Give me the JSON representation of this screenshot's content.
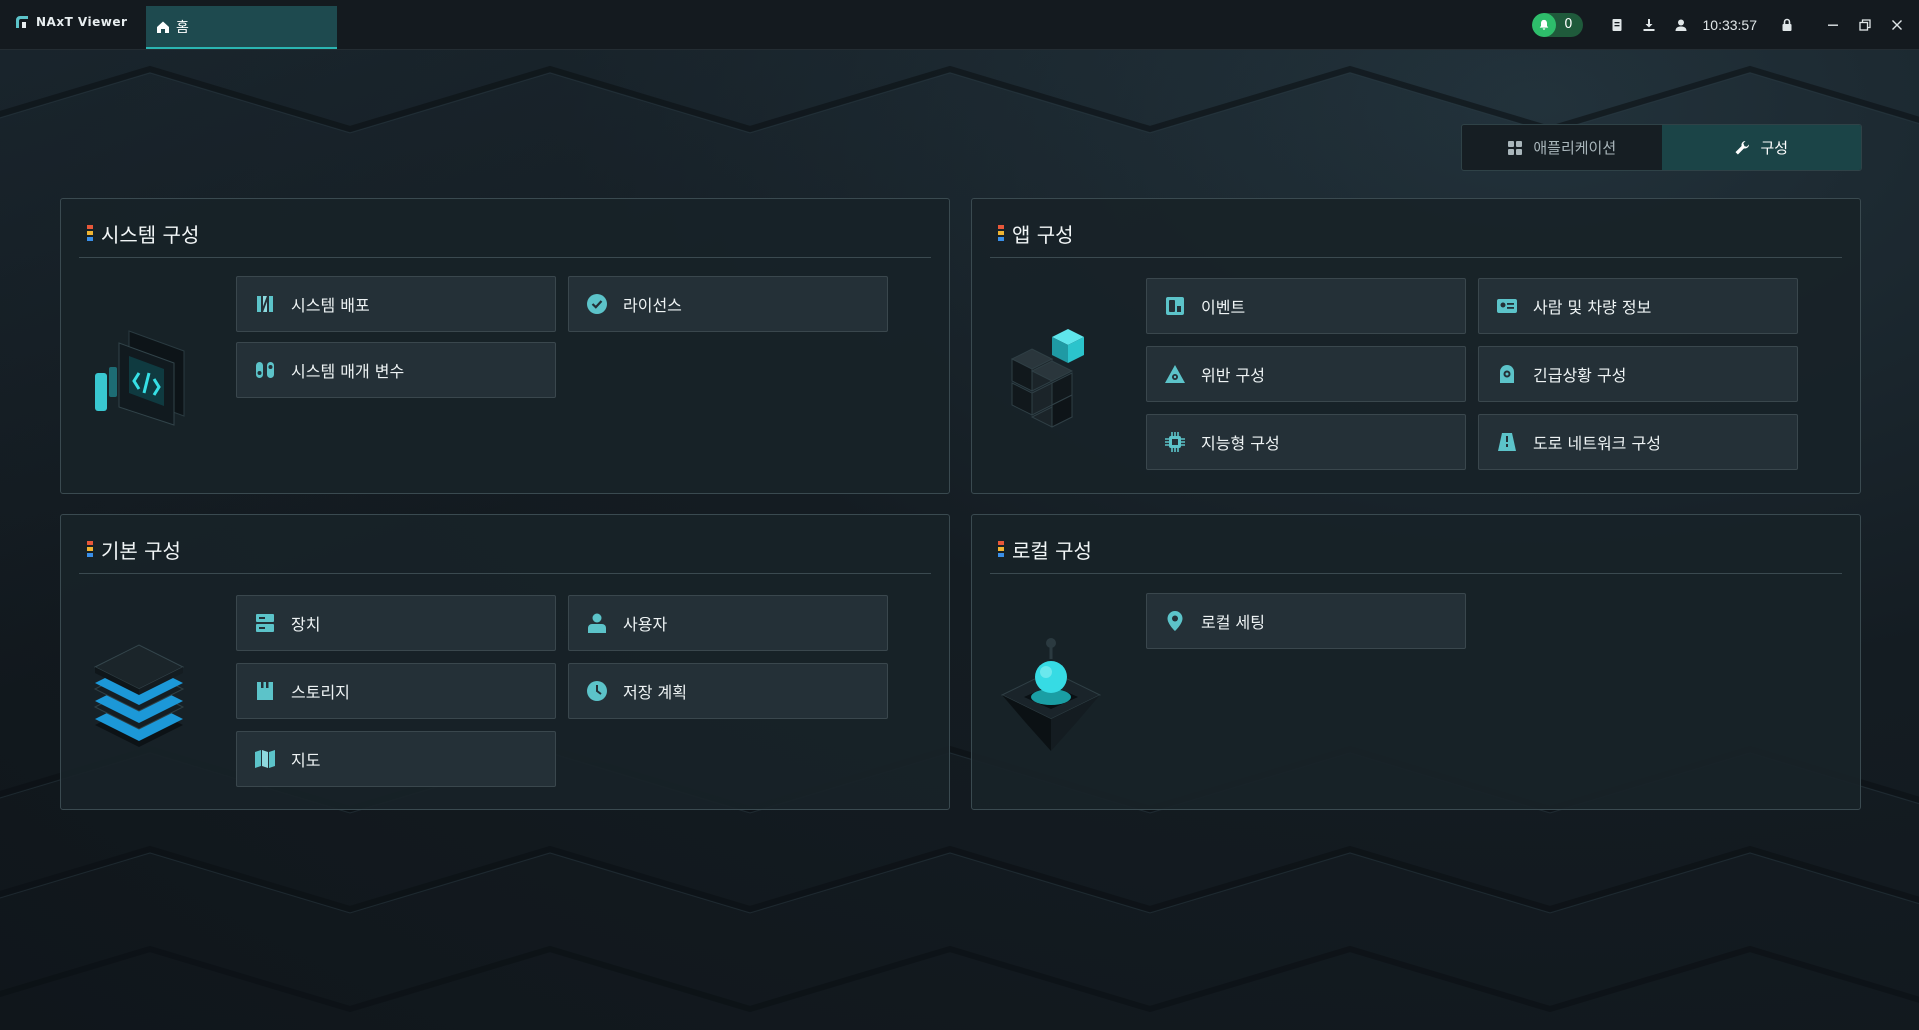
{
  "app": {
    "name": "NAxT Viewer"
  },
  "tabs": [
    {
      "label": "홈",
      "icon": "home-icon"
    }
  ],
  "toolbar": {
    "notification_count": "0",
    "clock": "10:33:57"
  },
  "segment": {
    "applications_label": "애플리케이션",
    "config_label": "구성",
    "active": "구성"
  },
  "panels": {
    "system": {
      "title": "시스템 구성",
      "items": [
        {
          "label": "시스템 배포",
          "icon": "deploy-icon"
        },
        {
          "label": "라이선스",
          "icon": "license-check-icon"
        },
        {
          "label": "시스템 매개 변수",
          "icon": "parameter-icon"
        }
      ]
    },
    "app": {
      "title": "앱 구성",
      "items": [
        {
          "label": "이벤트",
          "icon": "event-icon"
        },
        {
          "label": "사람 및 차량 정보",
          "icon": "id-card-icon"
        },
        {
          "label": "위반 구성",
          "icon": "violation-icon"
        },
        {
          "label": "긴급상황 구성",
          "icon": "emergency-icon"
        },
        {
          "label": "지능형 구성",
          "icon": "chip-icon"
        },
        {
          "label": "도로 네트워크 구성",
          "icon": "road-icon"
        }
      ]
    },
    "basic": {
      "title": "기본 구성",
      "items": [
        {
          "label": "장치",
          "icon": "device-icon"
        },
        {
          "label": "사용자",
          "icon": "user-icon"
        },
        {
          "label": "스토리지",
          "icon": "storage-icon"
        },
        {
          "label": "저장 계획",
          "icon": "clock-icon"
        },
        {
          "label": "지도",
          "icon": "map-icon"
        }
      ]
    },
    "local": {
      "title": "로컬 구성",
      "items": [
        {
          "label": "로컬 세팅",
          "icon": "location-pin-icon"
        }
      ]
    }
  },
  "colors": {
    "accent": "#2bb5b2",
    "icon": "#5cc3c9",
    "panel_bg": "#182228",
    "item_bg": "#243037",
    "mark_colors": [
      "#e8583a",
      "#f0b432",
      "#3a8fe8"
    ]
  }
}
